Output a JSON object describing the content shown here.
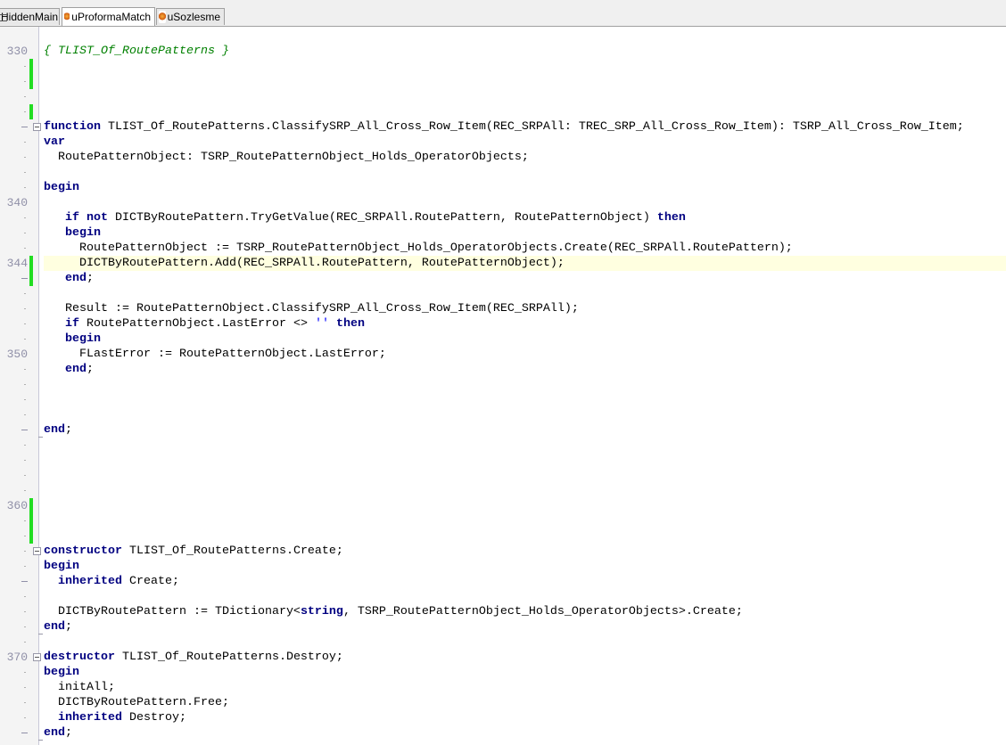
{
  "tabs": [
    {
      "label": "HiddenMain",
      "icon": "page-icon",
      "active": false
    },
    {
      "label": "uProformaMatch",
      "icon": "delphi-unit-icon",
      "active": true
    },
    {
      "label": "uSozlesme",
      "icon": "delphi-unit-icon",
      "active": false
    }
  ],
  "editor": {
    "first_line": 330,
    "current_line": 344,
    "colors": {
      "keyword": "#000080",
      "comment": "#008000",
      "string": "#0000ff",
      "change_bar": "#22dd22",
      "current_line_bg": "#ffffe0"
    },
    "line_numbers_shown": {
      "330": "330",
      "340": "340",
      "344": "344",
      "350": "350",
      "360": "360",
      "370": "370"
    },
    "changed_lines": [
      331,
      332,
      334,
      344,
      345,
      360,
      361,
      362
    ],
    "fold_starts": [
      335,
      363,
      370
    ],
    "fold_ends": [
      355,
      368,
      375
    ],
    "dash_markers": [
      335,
      345,
      355,
      365,
      375
    ],
    "lines": [
      [
        [
          "{ TLIST_Of_RoutePatterns }",
          "c"
        ]
      ],
      [],
      [],
      [],
      [],
      [
        [
          "function",
          "k"
        ],
        [
          " TLIST_Of_RoutePatterns.ClassifySRP_All_Cross_Row_Item(REC_SRPAll: TREC_SRP_All_Cross_Row_Item): TSRP_All_Cross_Row_Item;",
          "t"
        ]
      ],
      [
        [
          "var",
          "k"
        ]
      ],
      [
        [
          "  RoutePatternObject: TSRP_RoutePatternObject_Holds_OperatorObjects;",
          "t"
        ]
      ],
      [],
      [
        [
          "begin",
          "k"
        ]
      ],
      [],
      [
        [
          "   ",
          "t"
        ],
        [
          "if not",
          "k"
        ],
        [
          " DICTByRoutePattern.TryGetValue(REC_SRPAll.RoutePattern, RoutePatternObject) ",
          "t"
        ],
        [
          "then",
          "k"
        ]
      ],
      [
        [
          "   ",
          "t"
        ],
        [
          "begin",
          "k"
        ]
      ],
      [
        [
          "     RoutePatternObject := TSRP_RoutePatternObject_Holds_OperatorObjects.Create(REC_SRPAll.RoutePattern);",
          "t"
        ]
      ],
      [
        [
          "     DICTByRoutePattern.Add(REC_SRPAll.RoutePattern, RoutePatternObject);",
          "t"
        ]
      ],
      [
        [
          "   ",
          "t"
        ],
        [
          "end",
          "k"
        ],
        [
          ";",
          "t"
        ]
      ],
      [],
      [
        [
          "   Result := RoutePatternObject.ClassifySRP_All_Cross_Row_Item(REC_SRPAll);",
          "t"
        ]
      ],
      [
        [
          "   ",
          "t"
        ],
        [
          "if",
          "k"
        ],
        [
          " RoutePatternObject.LastError <> ",
          "t"
        ],
        [
          "''",
          "s"
        ],
        [
          " ",
          "t"
        ],
        [
          "then",
          "k"
        ]
      ],
      [
        [
          "   ",
          "t"
        ],
        [
          "begin",
          "k"
        ]
      ],
      [
        [
          "     FLastError := RoutePatternObject.LastError;",
          "t"
        ]
      ],
      [
        [
          "   ",
          "t"
        ],
        [
          "end",
          "k"
        ],
        [
          ";",
          "t"
        ]
      ],
      [],
      [],
      [],
      [
        [
          "end",
          "k"
        ],
        [
          ";",
          "t"
        ]
      ],
      [],
      [],
      [],
      [],
      [],
      [],
      [],
      [
        [
          "constructor",
          "k"
        ],
        [
          " TLIST_Of_RoutePatterns.Create;",
          "t"
        ]
      ],
      [
        [
          "begin",
          "k"
        ]
      ],
      [
        [
          "  ",
          "t"
        ],
        [
          "inherited",
          "k"
        ],
        [
          " Create;",
          "t"
        ]
      ],
      [],
      [
        [
          "  DICTByRoutePattern := TDictionary<",
          "t"
        ],
        [
          "string",
          "k"
        ],
        [
          ", TSRP_RoutePatternObject_Holds_OperatorObjects>.Create;",
          "t"
        ]
      ],
      [
        [
          "end",
          "k"
        ],
        [
          ";",
          "t"
        ]
      ],
      [],
      [
        [
          "destructor",
          "k"
        ],
        [
          " TLIST_Of_RoutePatterns.Destroy;",
          "t"
        ]
      ],
      [
        [
          "begin",
          "k"
        ]
      ],
      [
        [
          "  initAll;",
          "t"
        ]
      ],
      [
        [
          "  DICTByRoutePattern.Free;",
          "t"
        ]
      ],
      [
        [
          "  ",
          "t"
        ],
        [
          "inherited",
          "k"
        ],
        [
          " Destroy;",
          "t"
        ]
      ],
      [
        [
          "end",
          "k"
        ],
        [
          ";",
          "t"
        ]
      ]
    ]
  }
}
